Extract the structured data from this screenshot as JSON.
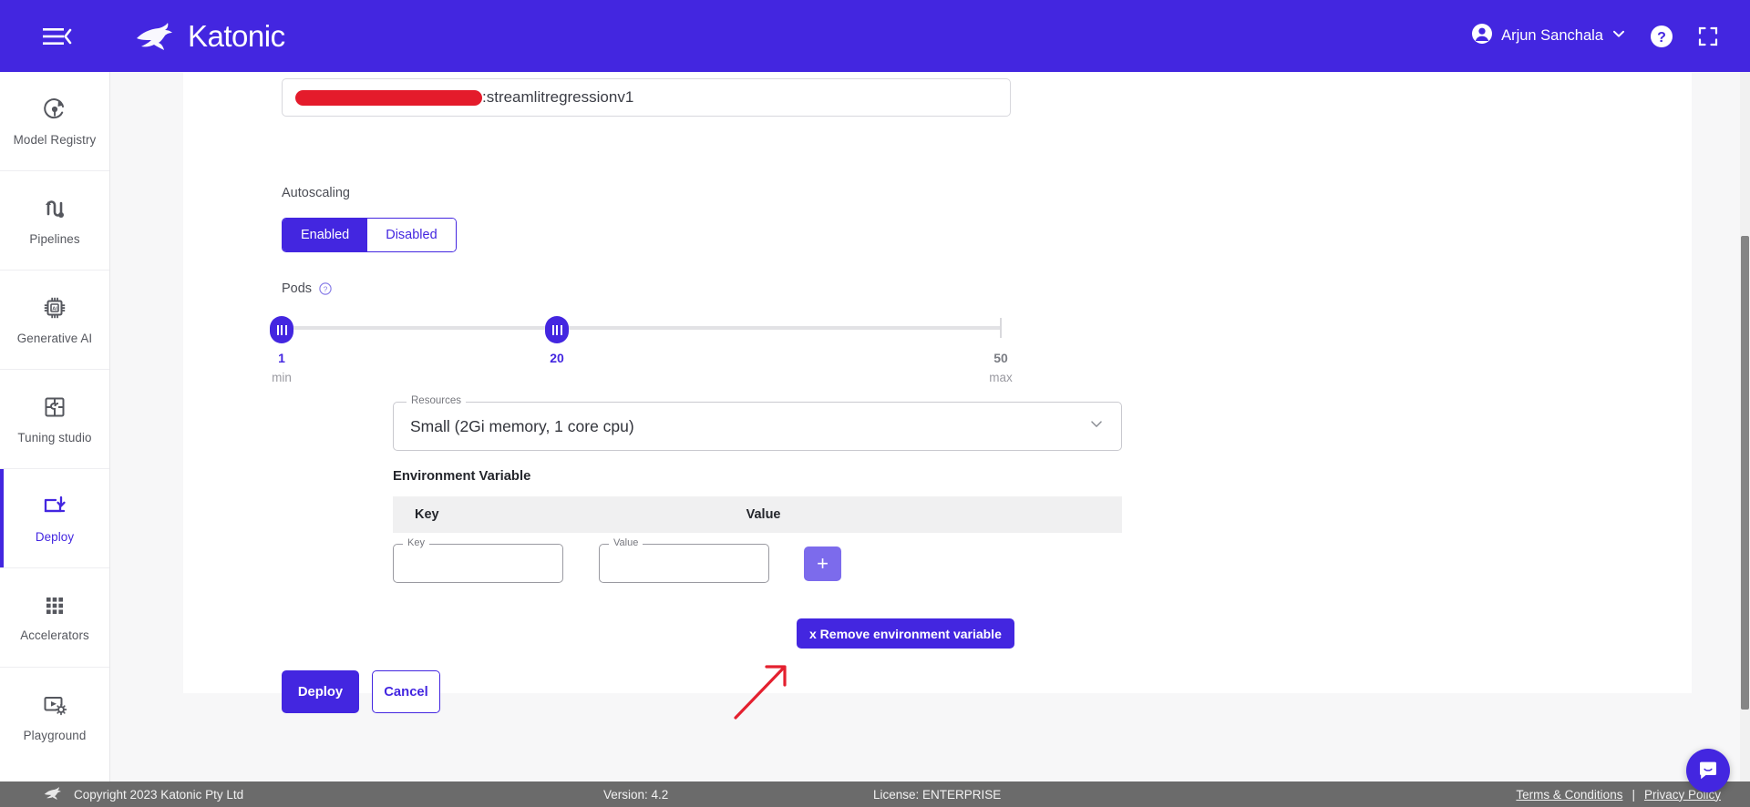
{
  "header": {
    "brand_name": "Katonic",
    "menu_icon": "hamburger-collapse-icon",
    "user_name": "Arjun Sanchala",
    "help_icon": "question-circle-icon",
    "fullscreen_icon": "fullscreen-expand-icon",
    "brand_color": "#4326e0"
  },
  "sidebar": {
    "items": [
      {
        "label": "Model Registry",
        "icon": "model-registry-icon",
        "active": false
      },
      {
        "label": "Pipelines",
        "icon": "pipelines-icon",
        "active": false
      },
      {
        "label": "Generative AI",
        "icon": "generative-ai-chip-icon",
        "active": false
      },
      {
        "label": "Tuning studio",
        "icon": "puzzle-tuning-icon",
        "active": false
      },
      {
        "label": "Deploy",
        "icon": "deploy-download-icon",
        "active": true
      },
      {
        "label": "Accelerators",
        "icon": "accelerators-grid-icon",
        "active": false
      },
      {
        "label": "Playground",
        "icon": "playground-media-gear-icon",
        "active": false
      }
    ]
  },
  "form": {
    "image_field": {
      "redacted": true,
      "visible_text": ":streamlitregressionv1"
    },
    "autoscaling": {
      "label": "Autoscaling",
      "options": [
        "Enabled",
        "Disabled"
      ],
      "selected": "Enabled"
    },
    "pods": {
      "label": "Pods",
      "help_icon": "help-circle-icon",
      "min_value": "1",
      "min_caption": "min",
      "current_value": "20",
      "max_value": "50",
      "max_caption": "max",
      "range_min": 1,
      "range_max": 50,
      "selected_low": 1,
      "selected_high": 20
    },
    "resources": {
      "legend": "Resources",
      "value": "Small (2Gi memory, 1 core cpu)",
      "chevron_icon": "chevron-down-icon"
    },
    "environment_variable": {
      "section_label": "Environment Variable",
      "columns": [
        "Key",
        "Value"
      ],
      "rows": [
        {
          "key_legend": "Key",
          "key_value": "",
          "key_placeholder": "",
          "value_legend": "Value",
          "value_value": "",
          "value_placeholder": ""
        }
      ],
      "add_button_label": "+",
      "remove_button_label": "x Remove environment variable"
    },
    "actions": {
      "deploy_label": "Deploy",
      "cancel_label": "Cancel"
    }
  },
  "annotation": {
    "arrow_color": "#e4202f",
    "points_to": "remove-environment-variable-button"
  },
  "footer": {
    "copyright": "Copyright 2023 Katonic Pty Ltd",
    "version": "Version: 4.2",
    "license": "License: ENTERPRISE",
    "terms_link": "Terms & Conditions",
    "separator": "|",
    "privacy_link": "Privacy Policy"
  },
  "chat_widget": {
    "icon": "chat-bubble-icon"
  }
}
